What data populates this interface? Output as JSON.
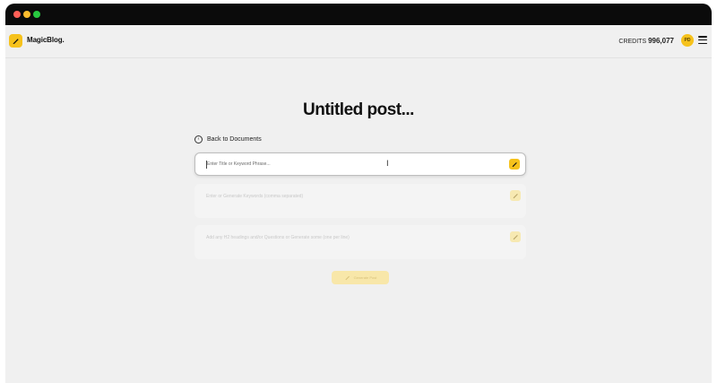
{
  "app": {
    "name": "MagicBlog.",
    "credits_label": "CREDITS",
    "credits_value": "996,077",
    "avatar_initials": "PD"
  },
  "page": {
    "title": "Untitled post...",
    "back_label": "Back to Documents"
  },
  "fields": {
    "title_placeholder": "Enter Title or Keyword Phrase...",
    "keywords_placeholder": "Enter or Generate Keywords (comma separated)",
    "headings_placeholder": "Add any H2 headings and/or Questions or Generate some (one per line)"
  },
  "generate_button": "Generate Post",
  "colors": {
    "accent": "#f6c21c",
    "background": "#f0f0f0",
    "titlebar": "#0b0b0b"
  },
  "icons": [
    "pencil-icon",
    "back-icon",
    "menu-icon",
    "wand-icon"
  ]
}
